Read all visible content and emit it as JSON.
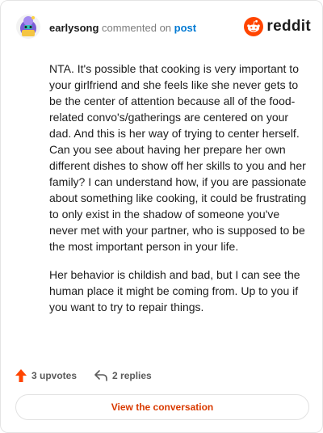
{
  "header": {
    "username": "earlysong",
    "action_text": "commented on",
    "post_link": "post",
    "brand": "reddit"
  },
  "comment": {
    "paragraphs": [
      "NTA. It's possible that cooking is very important to your girlfriend and she feels like she never gets to be the center of attention because all of the food-related convo's/gatherings are centered on your dad. And this is her way of trying to center herself. Can you see about having her prepare her own different dishes to show off her skills to you and her family? I can understand how, if you are passionate about something like cooking, it could be frustrating to only exist in the shadow of someone you've never met with your partner, who is supposed to be the most important person in your life.",
      "Her behavior is childish and bad, but I can see the human place it might be coming from. Up to you if you want to try to repair things."
    ]
  },
  "actions": {
    "upvotes_label": "3 upvotes",
    "replies_label": "2 replies"
  },
  "cta": {
    "label": "View the conversation"
  },
  "colors": {
    "accent": "#d93a00",
    "upvote": "#ff4500",
    "link": "#0079d3"
  },
  "icons": [
    "avatar",
    "reddit-logo-icon",
    "upvote-arrow-icon",
    "reply-arrow-icon"
  ]
}
